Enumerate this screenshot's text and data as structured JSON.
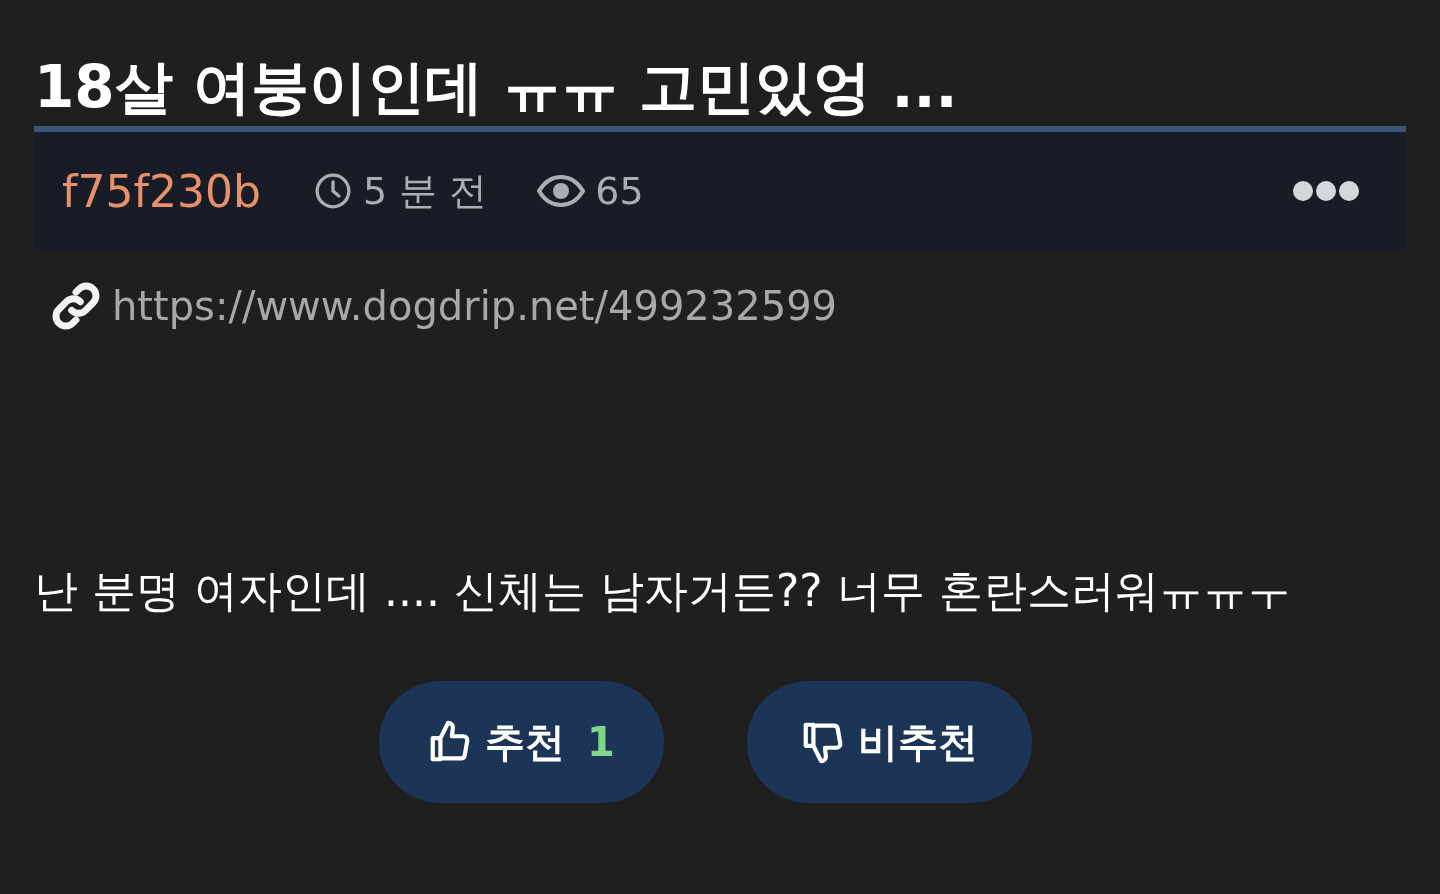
{
  "title": "18살 여붕이인데 ㅠㅠ 고민있엉 ...",
  "meta": {
    "author": "f75f230b",
    "time": "5 분 전",
    "views": "65"
  },
  "link": "https://www.dogdrip.net/499232599",
  "body": "난 분명 여자인데 .... 신체는 남자거든?? 너무 혼란스러워ㅠㅠㅜ",
  "votes": [
    {
      "kind": "up",
      "label": "추천",
      "count": "1"
    },
    {
      "kind": "down",
      "label": "비추천"
    }
  ]
}
